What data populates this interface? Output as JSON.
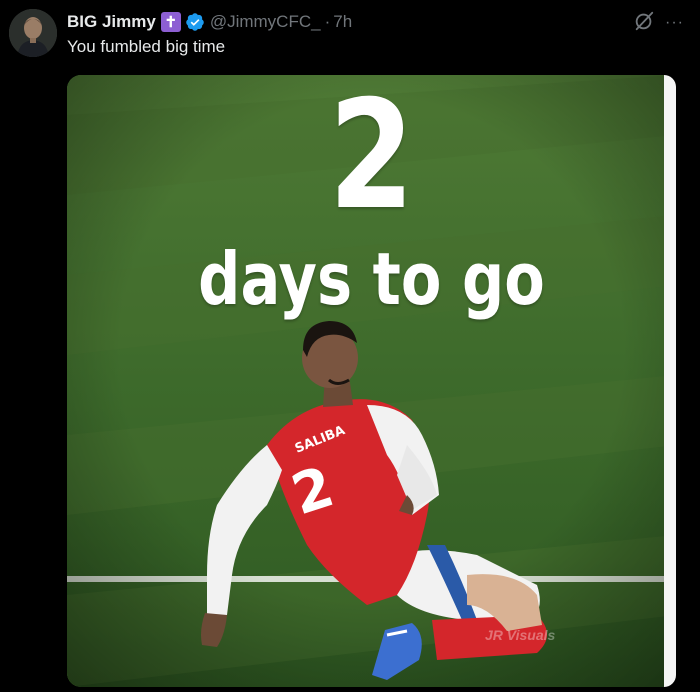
{
  "author": {
    "name": "BIG Jimmy",
    "emoji_badge": "✝",
    "handle": "@JimmyCFC_",
    "separator": "·",
    "time": "7h",
    "verified_color": "#1d9bf0"
  },
  "tweet": {
    "text": "You fumbled big time"
  },
  "media": {
    "countdown_number": "2",
    "countdown_caption": "days to go",
    "jersey_name": "SALIBA",
    "jersey_number": "2",
    "watermark": "JR Visuals"
  },
  "actions": {
    "more_label": "···"
  },
  "colors": {
    "background": "#000000",
    "text_primary": "#e7e9ea",
    "text_secondary": "#71767b",
    "pitch": "#3f6b2c",
    "jersey_red": "#d4262b"
  }
}
